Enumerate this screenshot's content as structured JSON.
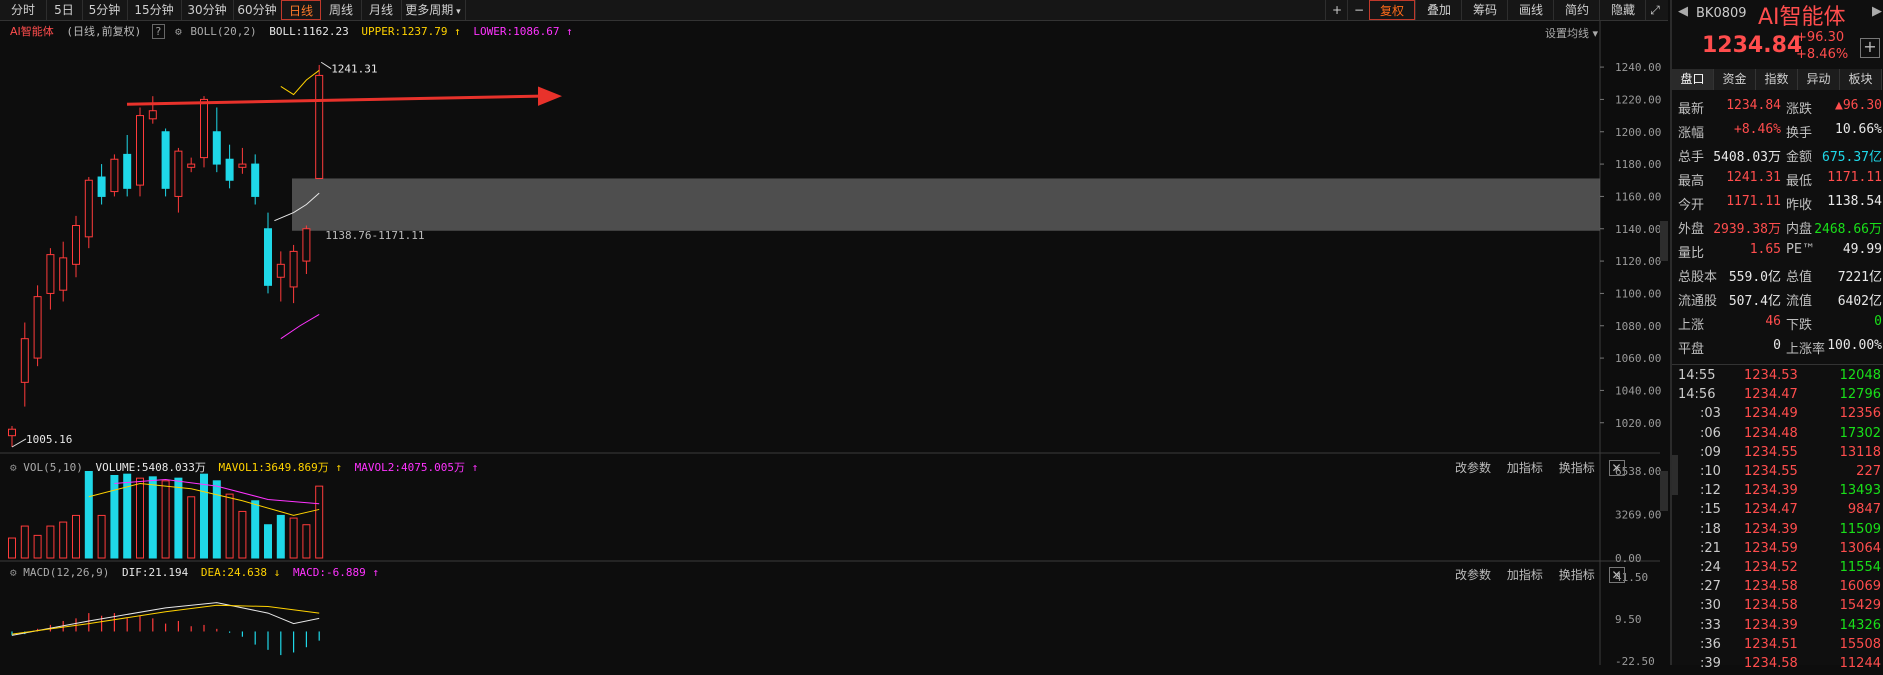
{
  "toolbar": {
    "periods": [
      "分时",
      "5日",
      "5分钟",
      "15分钟",
      "30分钟",
      "60分钟",
      "日线",
      "周线",
      "月线",
      "更多周期"
    ],
    "active_period": "日线",
    "right_buttons": [
      "+",
      "−",
      "复权",
      "叠加",
      "筹码",
      "画线",
      "简约",
      "隐藏"
    ],
    "highlight_button": "复权"
  },
  "header": {
    "name": "AI智能体",
    "mode": "(日线,前复权)",
    "help": "?",
    "indicator": "BOLL(20,2)",
    "boll": "BOLL:1162.23",
    "upper": "UPPER:1237.79",
    "lower": "LOWER:1086.67",
    "settings": "设置均线"
  },
  "price_axis": [
    "1240.00",
    "1220.00",
    "1200.00",
    "1180.00",
    "1160.00",
    "1140.00",
    "1120.00",
    "1100.00",
    "1080.00",
    "1060.00",
    "1040.00",
    "1020.00"
  ],
  "annotations": {
    "high": "1241.31",
    "low": "1005.16",
    "zone": "1138.76-1171.11"
  },
  "vol_panel": {
    "title": "VOL(5,10)",
    "volume": "VOLUME:5408.033万",
    "mavol1": "MAVOL1:3649.869万",
    "mavol2": "MAVOL2:4075.005万",
    "buttons": [
      "改参数",
      "加指标",
      "换指标"
    ],
    "close": "✕",
    "axis": [
      "6538.00",
      "3269.00",
      "0.00"
    ]
  },
  "macd_panel": {
    "title": "MACD(12,26,9)",
    "dif": "DIF:21.194",
    "dea": "DEA:24.638",
    "macd": "MACD:-6.889",
    "buttons": [
      "改参数",
      "加指标",
      "换指标"
    ],
    "close": "✕",
    "axis": [
      "41.50",
      "9.50",
      "-22.50"
    ]
  },
  "right_panel": {
    "code": "BK0809",
    "name": "AI智能体",
    "price": "1234.84",
    "change": "+96.30",
    "change_pct": "+8.46%",
    "plus": "+",
    "tabs": [
      "盘口",
      "资金",
      "指数",
      "异动",
      "板块"
    ],
    "stats": [
      {
        "l1": "最新",
        "v1": "1234.84",
        "c1": "red",
        "l2": "涨跌",
        "v2": "▲96.30",
        "c2": "red"
      },
      {
        "l1": "涨幅",
        "v1": "+8.46%",
        "c1": "red",
        "l2": "换手",
        "v2": "10.66%",
        "c2": "white"
      },
      {
        "l1": "总手",
        "v1": "5408.03万",
        "c1": "white",
        "l2": "金额",
        "v2": "675.37亿",
        "c2": "cyan"
      },
      {
        "l1": "最高",
        "v1": "1241.31",
        "c1": "red",
        "l2": "最低",
        "v2": "1171.11",
        "c2": "red"
      },
      {
        "l1": "今开",
        "v1": "1171.11",
        "c1": "red",
        "l2": "昨收",
        "v2": "1138.54",
        "c2": "white"
      },
      {
        "l1": "外盘",
        "v1": "2939.38万",
        "c1": "red",
        "l2": "内盘",
        "v2": "2468.66万",
        "c2": "green"
      },
      {
        "l1": "量比",
        "v1": "1.65",
        "c1": "red",
        "l2": "PE™",
        "v2": "49.99",
        "c2": "white"
      },
      {
        "l1": "总股本",
        "v1": "559.0亿",
        "c1": "white",
        "l2": "总值",
        "v2": "7221亿",
        "c2": "white"
      },
      {
        "l1": "流通股",
        "v1": "507.4亿",
        "c1": "white",
        "l2": "流值",
        "v2": "6402亿",
        "c2": "white"
      },
      {
        "l1": "上涨",
        "v1": "46",
        "c1": "red",
        "l2": "下跌",
        "v2": "0",
        "c2": "green"
      },
      {
        "l1": "平盘",
        "v1": "0",
        "c1": "white",
        "l2": "上涨率",
        "v2": "100.00%",
        "c2": "white"
      }
    ],
    "ticks": [
      {
        "t": "14:55",
        "p": "1234.53",
        "v": "12048",
        "c": "green"
      },
      {
        "t": "14:56",
        "p": "1234.47",
        "v": "12796",
        "c": "green"
      },
      {
        "t": ":03",
        "p": "1234.49",
        "v": "12356",
        "c": "red"
      },
      {
        "t": ":06",
        "p": "1234.48",
        "v": "17302",
        "c": "green"
      },
      {
        "t": ":09",
        "p": "1234.55",
        "v": "13118",
        "c": "red"
      },
      {
        "t": ":10",
        "p": "1234.55",
        "v": "227",
        "c": "red"
      },
      {
        "t": ":12",
        "p": "1234.39",
        "v": "13493",
        "c": "green"
      },
      {
        "t": ":15",
        "p": "1234.47",
        "v": "9847",
        "c": "red"
      },
      {
        "t": ":18",
        "p": "1234.39",
        "v": "11509",
        "c": "green"
      },
      {
        "t": ":21",
        "p": "1234.59",
        "v": "13064",
        "c": "red"
      },
      {
        "t": ":24",
        "p": "1234.52",
        "v": "11554",
        "c": "green"
      },
      {
        "t": ":27",
        "p": "1234.58",
        "v": "16069",
        "c": "red"
      },
      {
        "t": ":30",
        "p": "1234.58",
        "v": "15429",
        "c": "red"
      },
      {
        "t": ":33",
        "p": "1234.39",
        "v": "14326",
        "c": "green"
      },
      {
        "t": ":36",
        "p": "1234.51",
        "v": "15508",
        "c": "red"
      },
      {
        "t": ":39",
        "p": "1234.58",
        "v": "11244",
        "c": "red"
      }
    ]
  },
  "chart_data": [
    {
      "type": "candlestick",
      "candles": [
        {
          "o": 1012,
          "h": 1018,
          "l": 1005,
          "c": 1016
        },
        {
          "o": 1045,
          "h": 1082,
          "l": 1030,
          "c": 1072
        },
        {
          "o": 1060,
          "h": 1105,
          "l": 1055,
          "c": 1098
        },
        {
          "o": 1100,
          "h": 1128,
          "l": 1090,
          "c": 1124
        },
        {
          "o": 1102,
          "h": 1132,
          "l": 1095,
          "c": 1122
        },
        {
          "o": 1118,
          "h": 1148,
          "l": 1110,
          "c": 1142
        },
        {
          "o": 1135,
          "h": 1172,
          "l": 1128,
          "c": 1170
        },
        {
          "o": 1172,
          "h": 1180,
          "l": 1155,
          "c": 1160
        },
        {
          "o": 1163,
          "h": 1186,
          "l": 1160,
          "c": 1183
        },
        {
          "o": 1186,
          "h": 1198,
          "l": 1160,
          "c": 1165
        },
        {
          "o": 1167,
          "h": 1215,
          "l": 1160,
          "c": 1210
        },
        {
          "o": 1208,
          "h": 1222,
          "l": 1205,
          "c": 1213
        },
        {
          "o": 1200,
          "h": 1202,
          "l": 1160,
          "c": 1165
        },
        {
          "o": 1160,
          "h": 1190,
          "l": 1150,
          "c": 1188
        },
        {
          "o": 1178,
          "h": 1184,
          "l": 1175,
          "c": 1180
        },
        {
          "o": 1184,
          "h": 1222,
          "l": 1178,
          "c": 1220
        },
        {
          "o": 1200,
          "h": 1215,
          "l": 1175,
          "c": 1180
        },
        {
          "o": 1183,
          "h": 1192,
          "l": 1165,
          "c": 1170
        },
        {
          "o": 1178,
          "h": 1190,
          "l": 1174,
          "c": 1180
        },
        {
          "o": 1180,
          "h": 1186,
          "l": 1155,
          "c": 1160
        },
        {
          "o": 1140,
          "h": 1150,
          "l": 1100,
          "c": 1105
        },
        {
          "o": 1110,
          "h": 1126,
          "l": 1095,
          "c": 1118
        },
        {
          "o": 1104,
          "h": 1130,
          "l": 1094,
          "c": 1126
        },
        {
          "o": 1120,
          "h": 1142,
          "l": 1112,
          "c": 1140
        },
        {
          "o": 1171.11,
          "h": 1241.31,
          "l": 1171.11,
          "c": 1234.84
        }
      ],
      "ylim": [
        1005,
        1245
      ]
    },
    {
      "type": "bar",
      "name": "VOL",
      "values": [
        1500,
        2400,
        1700,
        2400,
        2700,
        3200,
        6500,
        3200,
        6200,
        6300,
        6000,
        6100,
        5800,
        6000,
        4600,
        6300,
        5800,
        4800,
        3500,
        4300,
        2500,
        3200,
        3000,
        2500,
        5400
      ],
      "colors": [
        "r",
        "r",
        "r",
        "r",
        "r",
        "r",
        "c",
        "r",
        "c",
        "c",
        "r",
        "c",
        "r",
        "c",
        "r",
        "c",
        "c",
        "r",
        "r",
        "c",
        "c",
        "c",
        "r",
        "r",
        "r"
      ],
      "ylim": [
        0,
        6538
      ]
    },
    {
      "type": "bar",
      "name": "MACD",
      "values": [
        -3,
        -2,
        2,
        5,
        8,
        10,
        14,
        12,
        14,
        10,
        12,
        10,
        6,
        8,
        4,
        5,
        2,
        -1,
        -4,
        -10,
        -14,
        -18,
        -16,
        -12,
        -7
      ],
      "ylim": [
        -22.5,
        41.5
      ]
    }
  ]
}
